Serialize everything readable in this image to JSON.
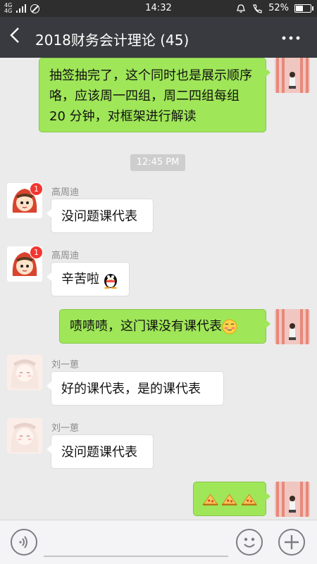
{
  "status_bar": {
    "network": "4G 4G",
    "time": "14:32",
    "battery": "52%",
    "battery_level": 0.52
  },
  "header": {
    "title": "2018财务会计理论 (45)",
    "back_icon": "back-chevron-icon",
    "more_icon": "more-dots-icon"
  },
  "messages": [
    {
      "id": "m1",
      "direction": "out",
      "text": "抽签抽完了，这个同时也是展示顺序咯，应该周一四组，周二四组每组 20 分钟，对框架进行解读"
    },
    {
      "id": "t1",
      "type": "time",
      "text": "12:45 PM"
    },
    {
      "id": "m2",
      "direction": "in",
      "sender": "高周迪",
      "badge": "1",
      "text": "没问题课代表"
    },
    {
      "id": "m3",
      "direction": "in",
      "sender": "高周迪",
      "badge": "1",
      "text": "辛苦啦",
      "emoji": "penguin"
    },
    {
      "id": "m4",
      "direction": "out",
      "text": "啧啧啧，这门课没有课代表",
      "emoji": "blush-face"
    },
    {
      "id": "m5",
      "direction": "in",
      "sender": "刘一葸",
      "text": "好的课代表，是的课代表"
    },
    {
      "id": "m6",
      "direction": "in",
      "sender": "刘一葸",
      "text": "没问题课代表"
    },
    {
      "id": "m7",
      "direction": "out",
      "text": "",
      "emoji": "pizza-x3"
    }
  ],
  "input_bar": {
    "voice_icon": "voice-icon",
    "emoji_icon": "smile-icon",
    "plus_icon": "plus-icon",
    "placeholder": ""
  },
  "colors": {
    "titlebar": "#393a3f",
    "out_bubble": "#9fe658",
    "in_bubble": "#ffffff",
    "background": "#ebebeb",
    "badge": "#f43530"
  }
}
